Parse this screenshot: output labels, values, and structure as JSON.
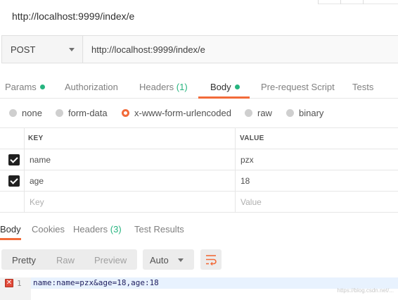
{
  "window": {
    "title": "http://localhost:9999/index/e"
  },
  "request": {
    "method": "POST",
    "url": "http://localhost:9999/index/e"
  },
  "request_tabs": {
    "params": "Params",
    "authorization": "Authorization",
    "headers": "Headers",
    "headers_count": "(1)",
    "body": "Body",
    "pre_request": "Pre-request Script",
    "tests": "Tests",
    "active": "Body"
  },
  "body_types": {
    "none": "none",
    "form_data": "form-data",
    "urlencoded": "x-www-form-urlencoded",
    "raw": "raw",
    "binary": "binary",
    "selected": "x-www-form-urlencoded"
  },
  "kv_table": {
    "headers": {
      "key": "KEY",
      "value": "VALUE"
    },
    "rows": [
      {
        "key": "name",
        "value": "pzx",
        "checked": true
      },
      {
        "key": "age",
        "value": "18",
        "checked": true
      }
    ],
    "placeholder": {
      "key": "Key",
      "value": "Value"
    }
  },
  "response_tabs": {
    "body": "Body",
    "cookies": "Cookies",
    "headers": "Headers",
    "headers_count": "(3)",
    "test_results": "Test Results",
    "active": "Body"
  },
  "response_toolbar": {
    "pretty": "Pretty",
    "raw": "Raw",
    "preview": "Preview",
    "format": "Auto",
    "active_view": "Pretty",
    "wrap_icon": "wrap-lines-icon"
  },
  "response_body": {
    "lines": [
      {
        "number": "1",
        "text": "name:name=pzx&age=18,age:18",
        "error": true
      }
    ],
    "error_icon": "error-x-icon",
    "error_glyph": "✕"
  },
  "watermark": "https://blog.csdn.net/...",
  "colors": {
    "accent": "#f26b3a",
    "green": "#26b47f",
    "error": "#e24b3b"
  }
}
